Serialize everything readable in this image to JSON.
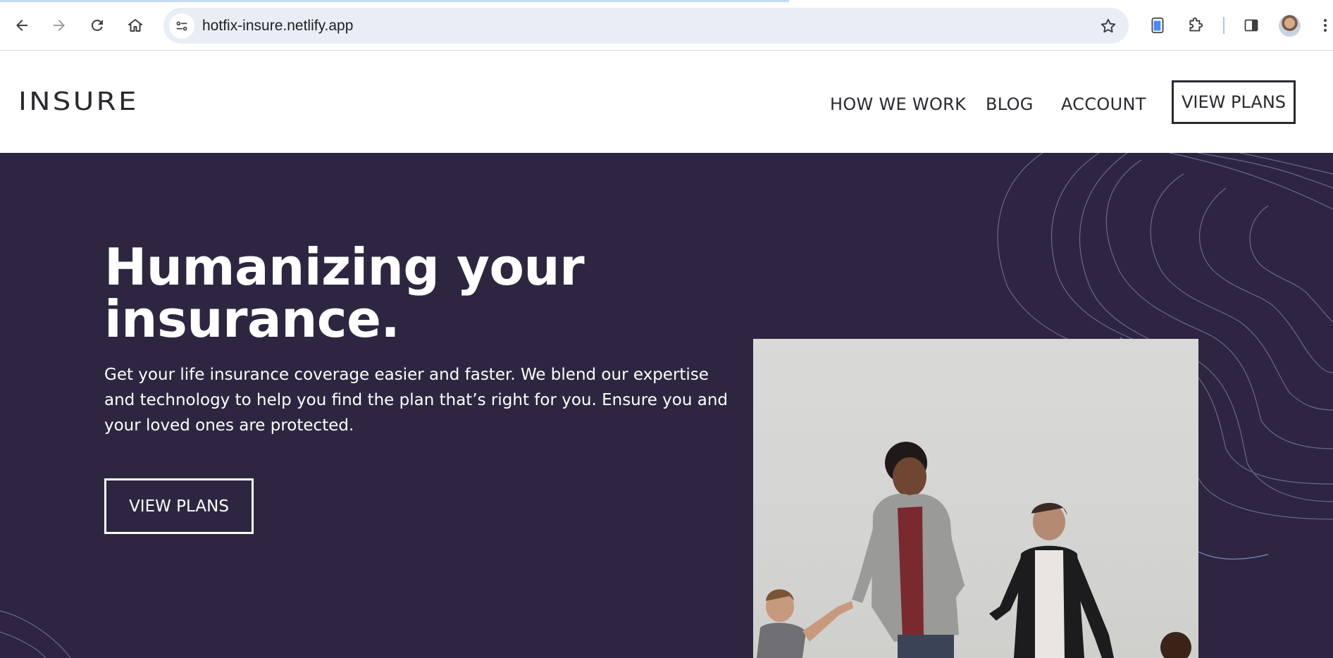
{
  "browser": {
    "url": "hotfix-insure.netlify.app",
    "icons": {
      "back": "back-arrow-icon",
      "forward": "forward-arrow-icon",
      "reload": "reload-icon",
      "home": "home-icon",
      "site_info": "tune-icon",
      "bookmark": "star-icon",
      "extension_1": "phone-extension-icon",
      "extensions": "puzzle-icon",
      "side_panel": "side-panel-icon",
      "menu": "kebab-menu-icon"
    }
  },
  "header": {
    "logo": "INSURE",
    "nav": {
      "how_we_work": "HOW WE WORK",
      "blog": "BLOG",
      "account": "ACCOUNT"
    },
    "cta": "VIEW PLANS"
  },
  "hero": {
    "title_line1": "Humanizing your",
    "title_line2": "insurance.",
    "description": "Get your life insurance coverage easier and faster. We blend our expertise and technology to help you find the plan that’s right for you. Ensure you and your loved ones are protected.",
    "cta": "VIEW PLANS"
  },
  "colors": {
    "hero_background": "#2e2641",
    "text_dark": "#2c2830",
    "white": "#ffffff"
  }
}
